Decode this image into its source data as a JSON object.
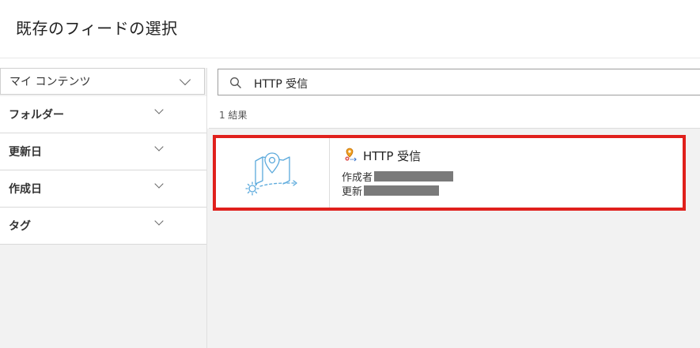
{
  "dialog": {
    "title": "既存のフィードの選択"
  },
  "sidebar": {
    "source_label": "マイ コンテンツ",
    "filters": [
      {
        "label": "フォルダー"
      },
      {
        "label": "更新日"
      },
      {
        "label": "作成日"
      },
      {
        "label": "タグ"
      }
    ]
  },
  "search": {
    "value": "HTTP 受信",
    "icon": "search-icon"
  },
  "results": {
    "count_label": "1 結果",
    "items": [
      {
        "title": "HTTP 受信",
        "icon": "http-receiver-icon",
        "thumbnail": "http-receiver-illustration",
        "author_label": "作成者",
        "updated_label": "更新"
      }
    ]
  },
  "colors": {
    "highlight": "#e0201c",
    "accent": "#5aa9dc",
    "panel_bg": "#f2f2f2"
  }
}
